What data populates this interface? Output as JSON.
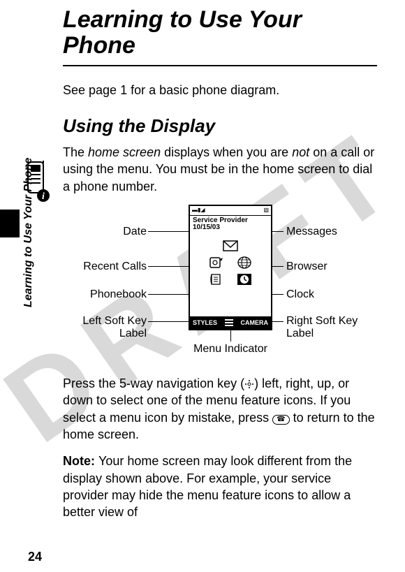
{
  "watermark": "DRAFT",
  "side_label": "Learning to Use Your Phone",
  "chapter_title": "Learning to Use Your Phone",
  "intro_line": "See page 1 for a basic phone diagram.",
  "section_title": "Using the Display",
  "para1_pre": "The ",
  "para1_em1": "home screen",
  "para1_mid": " displays when you are ",
  "para1_em2": "not",
  "para1_post": " on a call or using the menu. You must be in the home screen to dial a phone number.",
  "callouts": {
    "date": "Date",
    "recent_calls": "Recent Calls",
    "phonebook": "Phonebook",
    "left_soft_a": "Left Soft Key",
    "left_soft_b": "Label",
    "messages": "Messages",
    "browser": "Browser",
    "clock": "Clock",
    "right_soft_a": "Right Soft Key",
    "right_soft_b": "Label",
    "menu_indicator": "Menu Indicator"
  },
  "screen": {
    "signal_left": "▬▮◢",
    "signal_right": "▧",
    "provider": "Service Provider",
    "date": "10/15/03",
    "left_soft": "STYLES",
    "right_soft": "CAMERA"
  },
  "para2_pre": "Press the 5-way navigation key (",
  "para2_mid": ") left, right, up, or down to select one of the menu feature icons. If you select a menu icon by mistake, press ",
  "para2_post": " to return to the home screen.",
  "end_key_glyph": "☎",
  "note_label": "Note: ",
  "note_body": "Your home screen may look different from the display shown above. For example, your service provider may hide the menu feature icons to allow a better view of",
  "page_number": "24"
}
